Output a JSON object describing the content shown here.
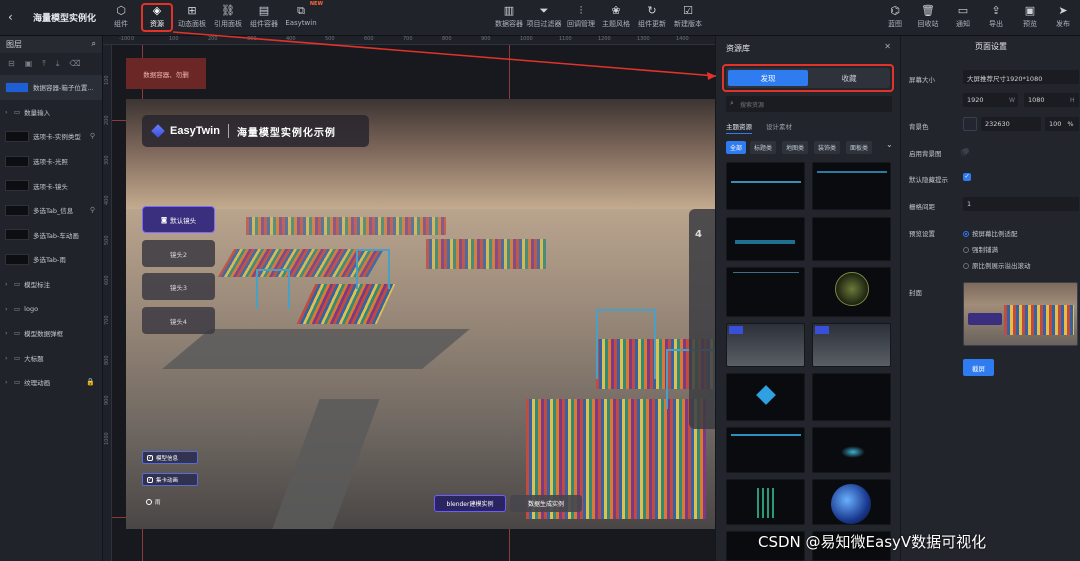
{
  "app": {
    "title": "海量模型实例化",
    "back_icon": "chevron-left-icon"
  },
  "toolbar": {
    "left_tools": [
      {
        "label": "组件",
        "icon": "hexagon-icon"
      },
      {
        "label": "资源",
        "icon": "layers-icon"
      },
      {
        "label": "动态面板",
        "icon": "grid-icon"
      },
      {
        "label": "引用面板",
        "icon": "link-icon"
      },
      {
        "label": "组件容器",
        "icon": "container-icon"
      },
      {
        "label": "Easytwin",
        "icon": "twin-icon",
        "badge": "NEW"
      }
    ],
    "center_tools": [
      {
        "label": "数据容器",
        "icon": "chart-icon"
      },
      {
        "label": "项目过滤器",
        "icon": "filter-icon"
      },
      {
        "label": "回调管理",
        "icon": "sliders-icon"
      },
      {
        "label": "主题风格",
        "icon": "palette-icon"
      },
      {
        "label": "组件更新",
        "icon": "refresh-icon"
      },
      {
        "label": "新建版本",
        "icon": "version-icon"
      }
    ],
    "right_tools": [
      {
        "label": "蓝图",
        "icon": "blueprint-icon"
      },
      {
        "label": "回收站",
        "icon": "trash-icon"
      },
      {
        "label": "通知",
        "icon": "message-icon"
      },
      {
        "label": "导出",
        "icon": "export-icon"
      },
      {
        "label": "预览",
        "icon": "preview-icon"
      },
      {
        "label": "发布",
        "icon": "send-icon"
      }
    ]
  },
  "layers": {
    "header": "图层",
    "items": [
      {
        "label": "数据容器-箱子位置...",
        "type": "item",
        "thumb": "blue"
      },
      {
        "label": "数量输入",
        "type": "folder"
      },
      {
        "label": "选项卡-实例类型",
        "type": "item",
        "icon": "pin-icon"
      },
      {
        "label": "选项卡-光照",
        "type": "item"
      },
      {
        "label": "选项卡-镜头",
        "type": "item"
      },
      {
        "label": "多选Tab_信息",
        "type": "item",
        "icon": "pin-icon"
      },
      {
        "label": "多选Tab-车动画",
        "type": "item"
      },
      {
        "label": "多选Tab-雨",
        "type": "item"
      },
      {
        "label": "模型标注",
        "type": "folder"
      },
      {
        "label": "logo",
        "type": "folder"
      },
      {
        "label": "模型数据弹框",
        "type": "folder"
      },
      {
        "label": "大标题",
        "type": "folder"
      },
      {
        "label": "纹理动画",
        "type": "folder",
        "icon": "lock-icon"
      }
    ]
  },
  "ruler": {
    "top": [
      "-100",
      "0",
      "100",
      "200",
      "300",
      "400",
      "500",
      "600",
      "700",
      "800",
      "900",
      "1000",
      "1100",
      "1200",
      "1300",
      "1400"
    ],
    "left": [
      "100",
      "200",
      "300",
      "400",
      "500",
      "600",
      "700",
      "800",
      "900",
      "1000"
    ]
  },
  "canvas": {
    "data_container_label": "数据容器、勿删",
    "brand_en": "EasyTwin",
    "brand_cn": "海量模型实例化示例",
    "camera_buttons": [
      "默认镜头",
      "镜头2",
      "镜头3",
      "镜头4"
    ],
    "side_card_number": "4",
    "toggles": [
      {
        "label": "模型信息",
        "checked": true
      },
      {
        "label": "集卡动画",
        "checked": true
      },
      {
        "label": "雨",
        "checked": false
      }
    ],
    "bottom_buttons": [
      "blender建模实例",
      "数据生成实例"
    ]
  },
  "assets": {
    "title": "资源库",
    "tabs": [
      "发现",
      "收藏"
    ],
    "search_placeholder": "搜索资源",
    "subtabs": [
      "主题资源",
      "设计素材"
    ],
    "categories": [
      "全部",
      "标题类",
      "地图类",
      "装饰类",
      "面板类"
    ]
  },
  "props": {
    "title": "页面设置",
    "screen_size_label": "屏幕大小",
    "screen_size_value": "大屏推荐尺寸1920*1080",
    "width": "1920",
    "width_unit": "W",
    "height": "1080",
    "height_unit": "H",
    "bg_color_label": "背景色",
    "bg_color_hex": "232630",
    "bg_opacity": "100",
    "bg_opacity_unit": "%",
    "bg_image_label": "启用背景图",
    "hidden_hint_label": "默认隐藏提示",
    "grid_label": "栅格间距",
    "grid_value": "1",
    "preview_label": "预览设置",
    "preview_options": [
      "按屏幕比例适配",
      "强制铺满",
      "原比例展示溢出滚动"
    ],
    "cover_label": "封面",
    "upload_label": "截屏"
  },
  "watermark": "CSDN @易知微EasyV数据可视化",
  "colors": {
    "accent": "#2f7bf0",
    "highlight": "#e2332a"
  }
}
